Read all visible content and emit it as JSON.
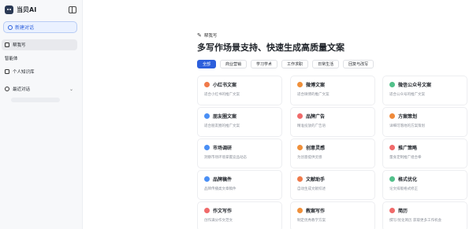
{
  "brand": {
    "name": "当贝AI"
  },
  "sidebar": {
    "new_chat": "新建对话",
    "items": [
      {
        "label": "帮我写",
        "active": true
      },
      {
        "label": "智能体",
        "active": false
      },
      {
        "label": "个人知识库",
        "active": false
      }
    ],
    "recent": {
      "label": "最近对话"
    }
  },
  "main": {
    "crumb": "帮我写",
    "headline": "多写作场景支持、快速生成高质量文案",
    "tabs": [
      {
        "label": "全部",
        "active": true
      },
      {
        "label": "商业营销",
        "active": false
      },
      {
        "label": "学习学术",
        "active": false
      },
      {
        "label": "工作求职",
        "active": false
      },
      {
        "label": "日常生活",
        "active": false
      },
      {
        "label": "回复与改写",
        "active": false
      }
    ],
    "cards": [
      {
        "title": "小红书文案",
        "desc": "适合小红书的推广文案",
        "color": "#f07a4a"
      },
      {
        "title": "微博文案",
        "desc": "适合微博的推广文案",
        "color": "#f0903a"
      },
      {
        "title": "微信公众号文案",
        "desc": "适合公众号的推广文案",
        "color": "#52c08a"
      },
      {
        "title": "朋友圈文案",
        "desc": "适合朋友圈的推广文案",
        "color": "#4a8ff5"
      },
      {
        "title": "品牌广告",
        "desc": "精准投放的广告语",
        "color": "#f06a6a"
      },
      {
        "title": "方案策划",
        "desc": "详细可落地的方案策划",
        "color": "#f08a3a"
      },
      {
        "title": "市场调研",
        "desc": "洞察市场环境掌握竞品动态",
        "color": "#4a8ff5"
      },
      {
        "title": "创意灵感",
        "desc": "为创意提供灵感",
        "color": "#f0903a"
      },
      {
        "title": "推广策略",
        "desc": "量身定制推广组合拳",
        "color": "#f06a6a"
      },
      {
        "title": "品牌稿件",
        "desc": "品牌传播类文章稿件",
        "color": "#4a8ff5"
      },
      {
        "title": "文献助手",
        "desc": "自动生成文献综述",
        "color": "#f07a4a"
      },
      {
        "title": "格式优化",
        "desc": "论文排版格式修正",
        "color": "#52c08a"
      },
      {
        "title": "作文写作",
        "desc": "创作满分作文范文",
        "color": "#f06a6a"
      },
      {
        "title": "教案写作",
        "desc": "制定优秀教学方案",
        "color": "#f0903a"
      },
      {
        "title": "简历",
        "desc": "撰写/优化简历 获取更多工作机会",
        "color": "#f06a6a"
      }
    ]
  }
}
